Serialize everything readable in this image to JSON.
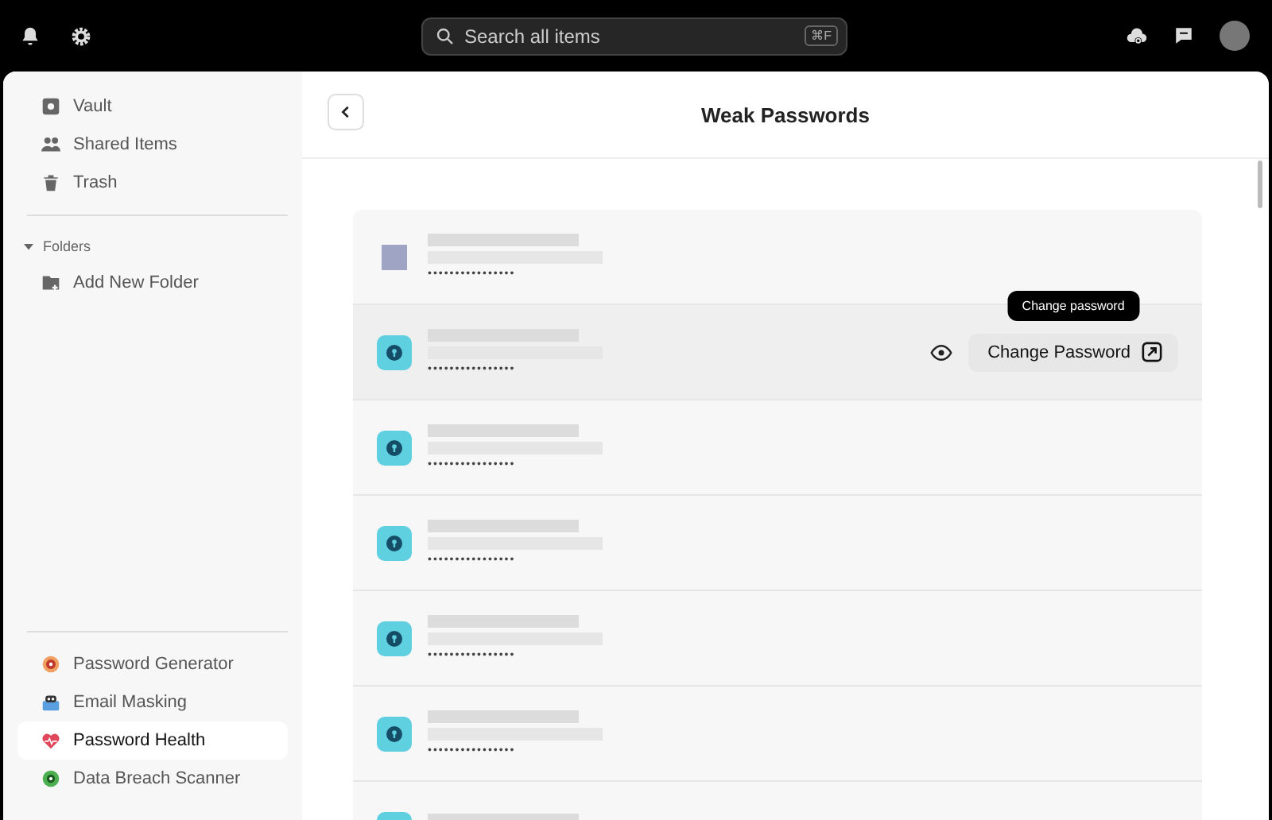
{
  "top_bar": {
    "search": {
      "placeholder": "Search all items",
      "shortcut": "⌘F"
    }
  },
  "sidebar": {
    "nav_items": [
      {
        "label": "Vault",
        "kind": "vault",
        "selected": false
      },
      {
        "label": "Shared Items",
        "kind": "shared",
        "selected": false
      },
      {
        "label": "Trash",
        "kind": "trash",
        "selected": false
      }
    ],
    "folders": {
      "label": "Folders",
      "expanded": true,
      "items": [
        {
          "label": "Add New Folder"
        }
      ]
    },
    "tools": [
      {
        "label": "Password Generator",
        "kind": "generator",
        "selected": false
      },
      {
        "label": "Email Masking",
        "kind": "masking",
        "selected": false
      },
      {
        "label": "Password Health",
        "kind": "health",
        "selected": true
      },
      {
        "label": "Data Breach Scanner",
        "kind": "scanner",
        "selected": false
      }
    ]
  },
  "main": {
    "title": "Weak Passwords",
    "rows": [
      {
        "kind": "image",
        "password": "••••••••••••••••",
        "hovered": false
      },
      {
        "kind": "login",
        "password": "••••••••••••••••",
        "hovered": true
      },
      {
        "kind": "login",
        "password": "••••••••••••••••",
        "hovered": false
      },
      {
        "kind": "login",
        "password": "••••••••••••••••",
        "hovered": false
      },
      {
        "kind": "login",
        "password": "••••••••••••••••",
        "hovered": false
      },
      {
        "kind": "login",
        "password": "••••••••••••••••",
        "hovered": false
      },
      {
        "kind": "login",
        "password": "",
        "hovered": false
      }
    ],
    "row_action": {
      "label": "Change Password",
      "tooltip": "Change password"
    }
  }
}
